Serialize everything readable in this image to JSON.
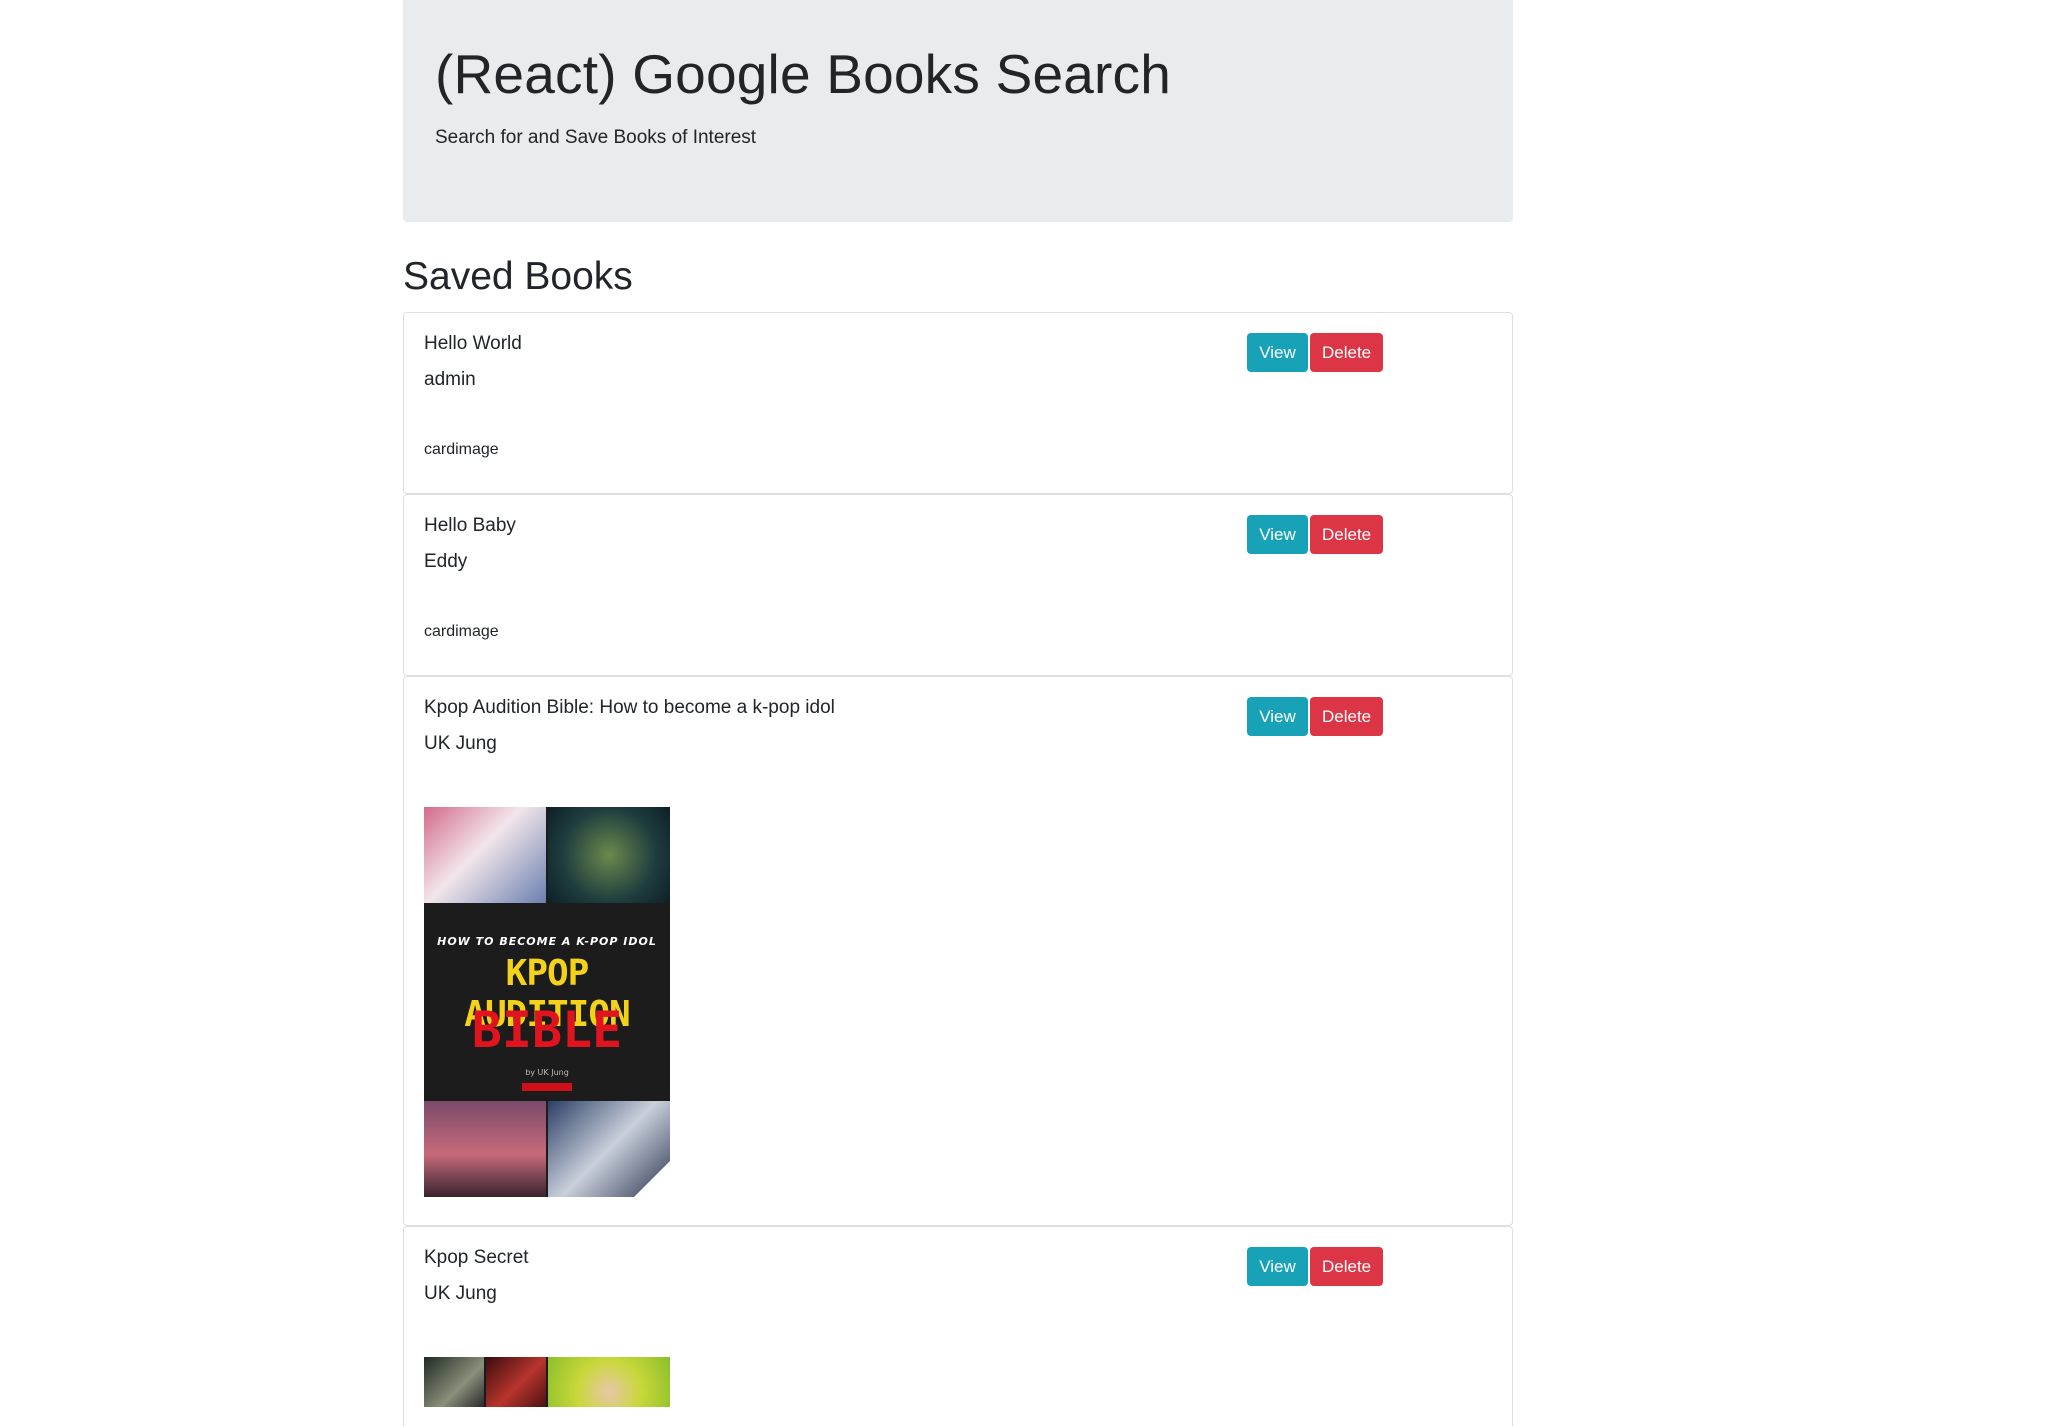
{
  "header": {
    "title": "(React) Google Books Search",
    "subtitle": "Search for and Save Books of Interest"
  },
  "section": {
    "title": "Saved Books"
  },
  "buttons": {
    "view_label": "View",
    "delete_label": "Delete"
  },
  "colors": {
    "view": "#17a2b8",
    "delete": "#dc3545",
    "jumbotron": "#e9ecef"
  },
  "books": [
    {
      "title": "Hello World",
      "author": "admin",
      "image_alt": "cardimage"
    },
    {
      "title": "Hello Baby",
      "author": "Eddy",
      "image_alt": "cardimage"
    },
    {
      "title": "Kpop Audition Bible: How to become a k-pop idol",
      "author": "UK Jung",
      "cover": {
        "subtitle": "HOW TO BECOME A K-POP IDOL",
        "line1": "KPOP AUDITION",
        "line2": "BIBLE",
        "byline": "by UK Jung"
      }
    },
    {
      "title": "Kpop Secret",
      "author": "UK Jung"
    }
  ]
}
